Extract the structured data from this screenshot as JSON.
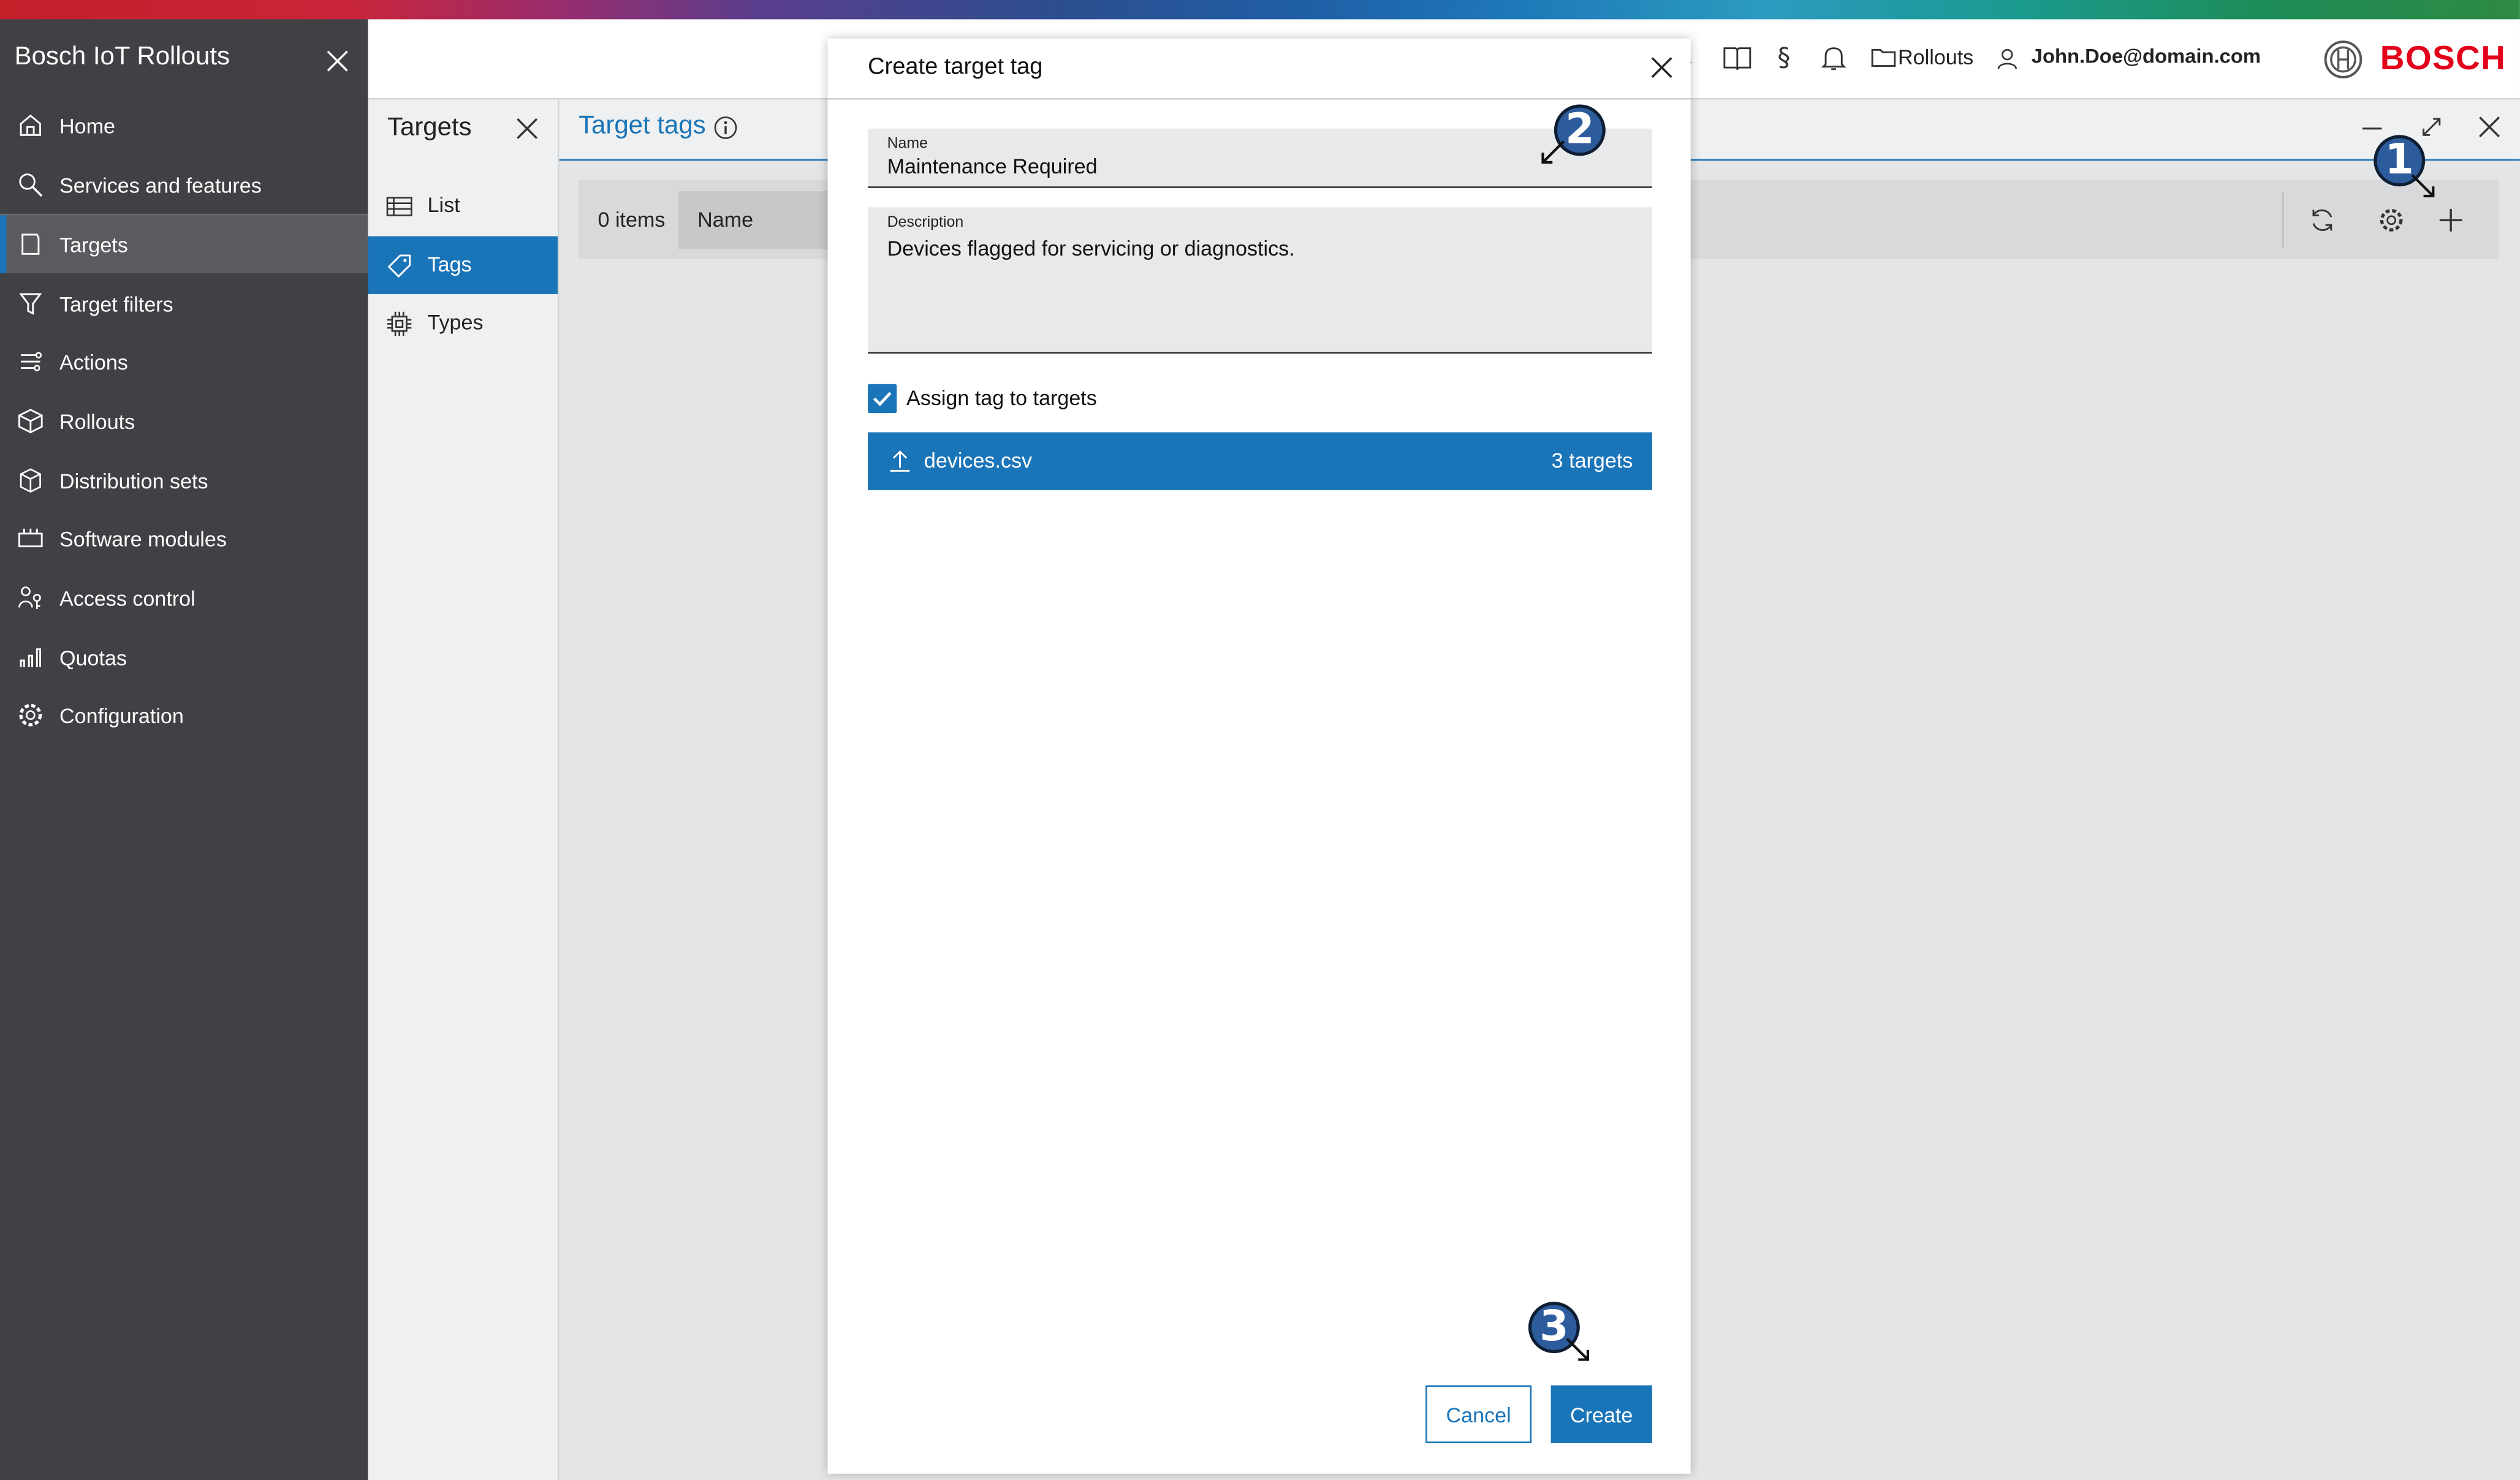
{
  "app": {
    "title": "Bosch IoT Rollouts",
    "brand": "BOSCH"
  },
  "colors": {
    "accent": "#1a74b8",
    "sidebar_bg": "#3f4144",
    "brand_red": "#e3001b"
  },
  "sidebar": {
    "items": [
      {
        "label": "Home",
        "icon": "home-icon"
      },
      {
        "label": "Services and features",
        "icon": "search-icon"
      },
      {
        "label": "Targets",
        "icon": "targets-icon",
        "active": true
      },
      {
        "label": "Target filters",
        "icon": "filter-icon"
      },
      {
        "label": "Actions",
        "icon": "actions-icon"
      },
      {
        "label": "Rollouts",
        "icon": "rollouts-icon"
      },
      {
        "label": "Distribution sets",
        "icon": "distribution-icon"
      },
      {
        "label": "Software modules",
        "icon": "modules-icon"
      },
      {
        "label": "Access control",
        "icon": "access-icon"
      },
      {
        "label": "Quotas",
        "icon": "quotas-icon"
      },
      {
        "label": "Configuration",
        "icon": "gear-icon"
      }
    ]
  },
  "header": {
    "rollouts_label": "Rollouts",
    "user": "John.Doe@domain.com"
  },
  "subnav": {
    "title": "Targets",
    "items": [
      {
        "label": "List",
        "icon": "list-icon"
      },
      {
        "label": "Tags",
        "icon": "tag-icon",
        "active": true
      },
      {
        "label": "Types",
        "icon": "chip-icon"
      }
    ]
  },
  "main": {
    "title": "Target tags",
    "items_count": "0 items",
    "sort_label": "Name"
  },
  "modal": {
    "title": "Create target tag",
    "name_label": "Name",
    "name_value": "Maintenance Required",
    "description_label": "Description",
    "description_value": "Devices flagged for servicing or diagnostics.",
    "assign_checked": true,
    "assign_label": "Assign tag to targets",
    "file_name": "devices.csv",
    "file_count": "3 targets",
    "cancel_label": "Cancel",
    "create_label": "Create"
  },
  "callouts": [
    "1",
    "2",
    "3"
  ]
}
